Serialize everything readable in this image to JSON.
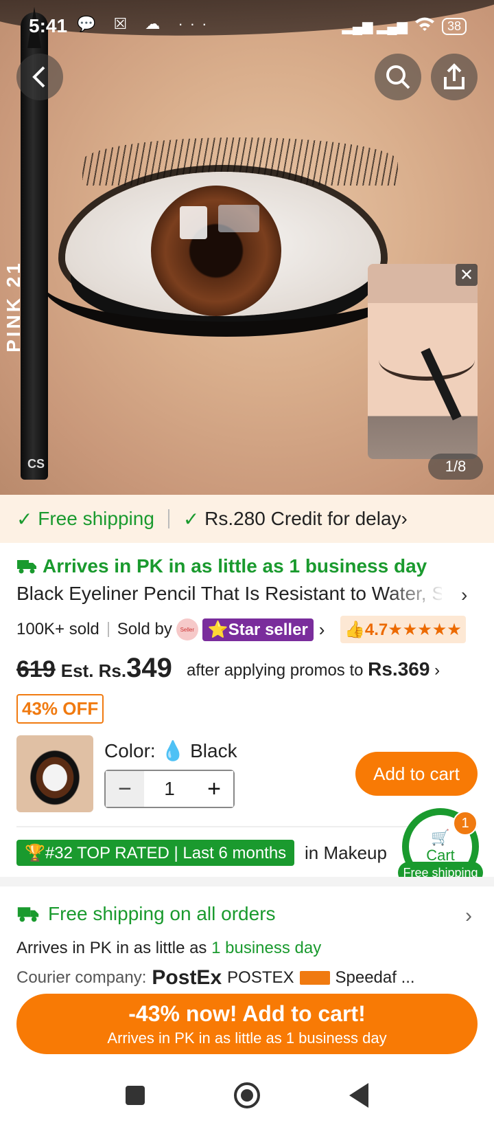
{
  "status_bar": {
    "time": "5:41",
    "icons": "💬 ☒ ☁ ···",
    "signal": "▂▄▆ ▂▄▆",
    "battery": "38"
  },
  "hero": {
    "pencil_text": "PINK 21",
    "pencil_brand": "CS",
    "page_counter": "1/8",
    "video_close": "✕"
  },
  "ship_bar": {
    "free_shipping": "Free shipping",
    "credit": "Rs.280 Credit for delay",
    "check": "✓",
    "chevron": "›"
  },
  "product": {
    "arrive": "Arrives in PK in as little as 1 business day",
    "title": "Black Eyeliner Pencil That Is Resistant to Water, Sweat and Smudge",
    "chevron": "›",
    "sold": "100K+ sold",
    "sold_by": "Sold by",
    "seller_logo": "Seller",
    "star_seller": "⭐Star seller",
    "seller_chevron": "›",
    "rating_text": "👍4.7★★★★★"
  },
  "price": {
    "old": "619",
    "est": "Est. Rs.",
    "new": "349",
    "promo_text": "after applying promos to ",
    "promo_price": "Rs.369",
    "promo_chevron": "›",
    "off_badge": "43% OFF"
  },
  "variant": {
    "color_label": "Color: ",
    "color_icon": "💧",
    "color_value": "Black",
    "minus": "−",
    "qty": "1",
    "plus": "+",
    "add_to_cart": "Add to cart"
  },
  "ranking": {
    "top_rated": "🏆#32 TOP RATED | Last 6 months",
    "in_category": "in Makeup"
  },
  "floating_cart": {
    "label": "Cart",
    "badge": "1",
    "free_shipping": "Free shipping",
    "icon": "🛒"
  },
  "shipping": {
    "title": "Free shipping on all orders",
    "chevron": "›",
    "arrive_prefix": "Arrives in PK in as little as ",
    "arrive_days": "1 business day",
    "courier_label": "Courier company:",
    "courier_logo_1": "PostEx",
    "courier_name_1": "POSTEX",
    "courier_name_2": "Speedaf ..."
  },
  "cta": {
    "line1": "-43% now! Add to cart!",
    "line2": "Arrives in PK in as little as 1 business day"
  },
  "colors": {
    "accent": "#f87a05",
    "green": "#1a9a2e",
    "purple": "#7a2d9c"
  }
}
